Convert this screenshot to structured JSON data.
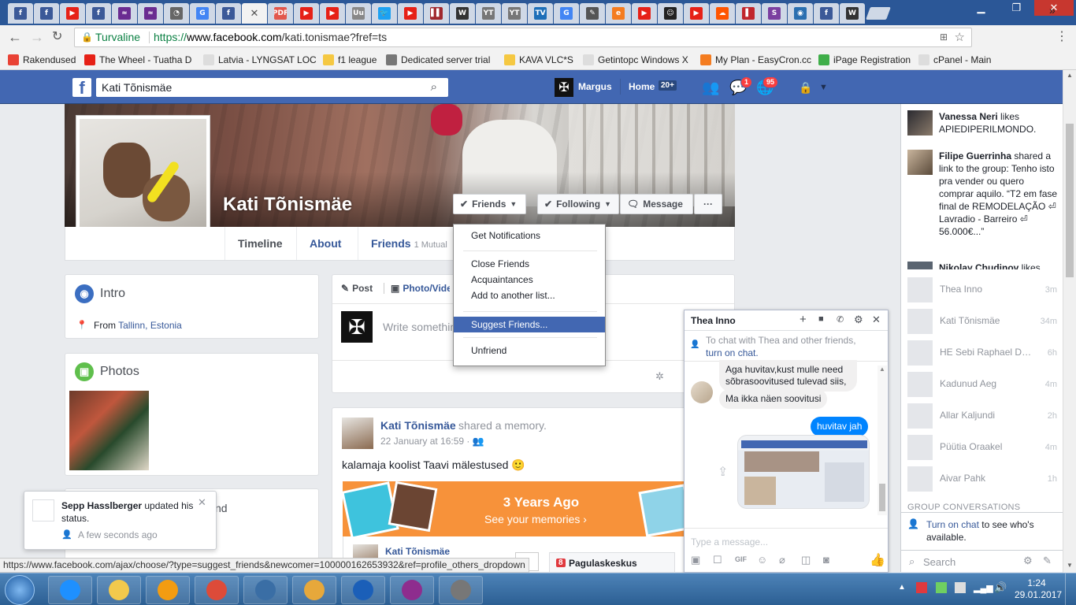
{
  "browser": {
    "tabs": [
      {
        "icon": "facebook-icon",
        "label": "f",
        "color": "#3b5998"
      },
      {
        "icon": "facebook-icon",
        "label": "f",
        "color": "#3b5998"
      },
      {
        "icon": "youtube-icon",
        "label": "▶",
        "color": "#e62117"
      },
      {
        "icon": "facebook-icon",
        "label": "f",
        "color": "#3b5998"
      },
      {
        "icon": "wave-icon",
        "label": "≈",
        "color": "#6a2c91"
      },
      {
        "icon": "wave-icon",
        "label": "≈",
        "color": "#6a2c91"
      },
      {
        "icon": "gauge-icon",
        "label": "◔",
        "color": "#666666"
      },
      {
        "icon": "google-icon",
        "label": "G",
        "color": "#4285f4"
      },
      {
        "icon": "facebook-icon",
        "label": "f",
        "color": "#3b5998"
      },
      {
        "icon": "close-icon",
        "label": "✕",
        "color": "#555555"
      },
      {
        "icon": "pdf-icon",
        "label": "PDF",
        "color": "#e2574c"
      },
      {
        "icon": "youtube-icon",
        "label": "▶",
        "color": "#e62117"
      },
      {
        "icon": "youtube-icon",
        "label": "▶",
        "color": "#e62117"
      },
      {
        "icon": "text-icon",
        "label": "Uu",
        "color": "#888888"
      },
      {
        "icon": "twitter-icon",
        "label": "🐦",
        "color": "#1da1f2"
      },
      {
        "icon": "youtube-icon",
        "label": "▶",
        "color": "#e62117"
      },
      {
        "icon": "bars-icon",
        "label": "▌▌",
        "color": "#a0282d"
      },
      {
        "icon": "wikipedia-icon",
        "label": "W",
        "color": "#333333"
      },
      {
        "icon": "yt-icon",
        "label": "YT",
        "color": "#777777"
      },
      {
        "icon": "yt-icon",
        "label": "YT",
        "color": "#777777"
      },
      {
        "icon": "kava-icon",
        "label": "TV",
        "color": "#1e6fb8"
      },
      {
        "icon": "google-icon",
        "label": "G",
        "color": "#4285f4"
      },
      {
        "icon": "tool-icon",
        "label": "✎",
        "color": "#555555"
      },
      {
        "icon": "easycron-icon",
        "label": "e",
        "color": "#f47c20"
      },
      {
        "icon": "youtube-icon",
        "label": "▶",
        "color": "#e62117"
      },
      {
        "icon": "smile-icon",
        "label": "☺",
        "color": "#222222"
      },
      {
        "icon": "youtube-icon",
        "label": "▶",
        "color": "#e62117"
      },
      {
        "icon": "soundcloud-icon",
        "label": "☁",
        "color": "#ff5500"
      },
      {
        "icon": "bookmark-icon",
        "label": "▌",
        "color": "#c1272d"
      },
      {
        "icon": "s-icon",
        "label": "S",
        "color": "#7b3fa0"
      },
      {
        "icon": "globe-icon",
        "label": "◉",
        "color": "#2a6fb0"
      },
      {
        "icon": "facebook-icon",
        "label": "f",
        "color": "#3b5998"
      },
      {
        "icon": "wikipedia-icon",
        "label": "W",
        "color": "#333333"
      }
    ],
    "omnibox": {
      "secure_label": "Turvaline",
      "url_scheme": "https://",
      "url_host": "www.facebook.com",
      "url_path": "/kati.tonismae?fref=ts"
    },
    "bookmarks": [
      {
        "label": "Rakendused",
        "icon": "apps-icon",
        "color": "#e94235"
      },
      {
        "label": "The Wheel - Tuatha D",
        "icon": "youtube-icon",
        "color": "#e62117"
      },
      {
        "label": "Latvia - LYNGSAT LOC",
        "icon": "page-icon",
        "color": "#dddddd"
      },
      {
        "label": "f1 league",
        "icon": "folder-icon",
        "color": "#f5c842"
      },
      {
        "label": "Dedicated server trial",
        "icon": "io-icon",
        "color": "#777777"
      },
      {
        "label": "KAVA VLC*S",
        "icon": "folder-icon",
        "color": "#f5c842"
      },
      {
        "label": "Getintopc Windows X",
        "icon": "page-icon",
        "color": "#dddddd"
      },
      {
        "label": "My Plan - EasyCron.cc",
        "icon": "easycron-icon",
        "color": "#f47c20"
      },
      {
        "label": "iPage Registration",
        "icon": "ipage-icon",
        "color": "#3fae49"
      },
      {
        "label": "cPanel - Main",
        "icon": "page-icon",
        "color": "#dddddd"
      }
    ],
    "bookmarks_overflow": "»",
    "status_url": "https://www.facebook.com/ajax/choose/?type=suggest_friends&newcomer=100000162653932&ref=profile_others_dropdown"
  },
  "fb": {
    "search_value": "Kati Tõnismäe",
    "user_name": "Margus",
    "home_label": "Home",
    "home_count": "20+",
    "messages_badge": "1",
    "notifications_badge": "95",
    "profile_name": "Kati Tõnismäe",
    "buttons": {
      "friends": "Friends",
      "following": "Following",
      "message": "Message",
      "more": "···"
    },
    "tabs": [
      {
        "label": "Timeline"
      },
      {
        "label": "About"
      },
      {
        "label": "Friends",
        "sub": "1 Mutual"
      }
    ],
    "dropdown": {
      "items": [
        "Get Notifications",
        "Close Friends",
        "Acquaintances",
        "Add to another list...",
        "Suggest Friends...",
        "Unfriend"
      ],
      "highlighted": "Suggest Friends..."
    },
    "intro": {
      "title": "Intro",
      "from_prefix": "From",
      "from_place": "Tallinn, Estonia"
    },
    "photos": {
      "title": "Photos"
    },
    "friends_card_partial": "nd",
    "composer": {
      "post_tab": "Post",
      "photo_tab": "Photo/Video",
      "placeholder": "Write something"
    },
    "post": {
      "author": "Kati Tõnismäe",
      "action": "shared a memory.",
      "time": "22 January at 16:59 ·",
      "text": "kalamaja koolist Taavi mälestused 🙂",
      "memory_title": "3 Years Ago",
      "memory_link": "See your memories",
      "inner_author": "Kati Tõnismäe",
      "side_badge": "8",
      "side_label": "Pagulaskeskus"
    },
    "ticker": [
      {
        "name": "Vanessa Neri",
        "text": " likes APIEDIPERILMONDO."
      },
      {
        "name": "Filipe Guerrinha",
        "text": " shared a link to the group: Tenho isto pra vender ou quero comprar aquilo. “T2 em fase final de REMODELAÇÃO ⏎ Lavradio - Barreiro ⏎ 56.000€...”"
      },
      {
        "name": "Nikolay Chudinov",
        "text": " likes"
      }
    ],
    "chat_contacts": [
      {
        "name": "Thea Inno",
        "time": "3m"
      },
      {
        "name": "Kati Tõnismäe",
        "time": "34m"
      },
      {
        "name": "HE Sebi Raphael Da...",
        "time": "6h"
      },
      {
        "name": "Kadunud Aeg",
        "time": "4m"
      },
      {
        "name": "Allar Kaljundi",
        "time": "2h"
      },
      {
        "name": "Püütia Oraakel",
        "time": "4m"
      },
      {
        "name": "Aivar Pahk",
        "time": "1h"
      }
    ],
    "group_conversations": "GROUP CONVERSATIONS",
    "turn_on_chat_link": "Turn on chat",
    "turn_on_chat_rest": " to see who's available.",
    "sidebar_search": "Search",
    "chat": {
      "title": "Thea Inno",
      "notice_prefix": "To chat with Thea and other friends,",
      "notice_link": "turn on chat.",
      "messages": [
        {
          "from": "in",
          "text": "Aga huvitav,kust mulle need sõbrasoovitused tulevad siis,"
        },
        {
          "from": "in",
          "text": "Ma ikka näen soovitusi"
        },
        {
          "from": "out",
          "text": "huvitav jah"
        }
      ],
      "input_placeholder": "Type a message..."
    },
    "notification": {
      "name": "Sepp Hasslberger",
      "text": " updated his status.",
      "time": "A few seconds ago"
    }
  },
  "taskbar": {
    "clock_time": "1:24",
    "clock_date": "29.01.2017",
    "apps": [
      {
        "icon": "ie-icon",
        "color": "#1e90ff"
      },
      {
        "icon": "explorer-icon",
        "color": "#f2c94c"
      },
      {
        "icon": "media-player-icon",
        "color": "#f39c12"
      },
      {
        "icon": "chrome-icon",
        "color": "#dd4b39"
      },
      {
        "icon": "thunderbird-icon",
        "color": "#3a6ea5"
      },
      {
        "icon": "paint-icon",
        "color": "#e7a83b"
      },
      {
        "icon": "help-icon",
        "color": "#1b5fb8"
      },
      {
        "icon": "winrar-icon",
        "color": "#8e2d8e"
      },
      {
        "icon": "microphone-icon",
        "color": "#777777"
      }
    ]
  }
}
